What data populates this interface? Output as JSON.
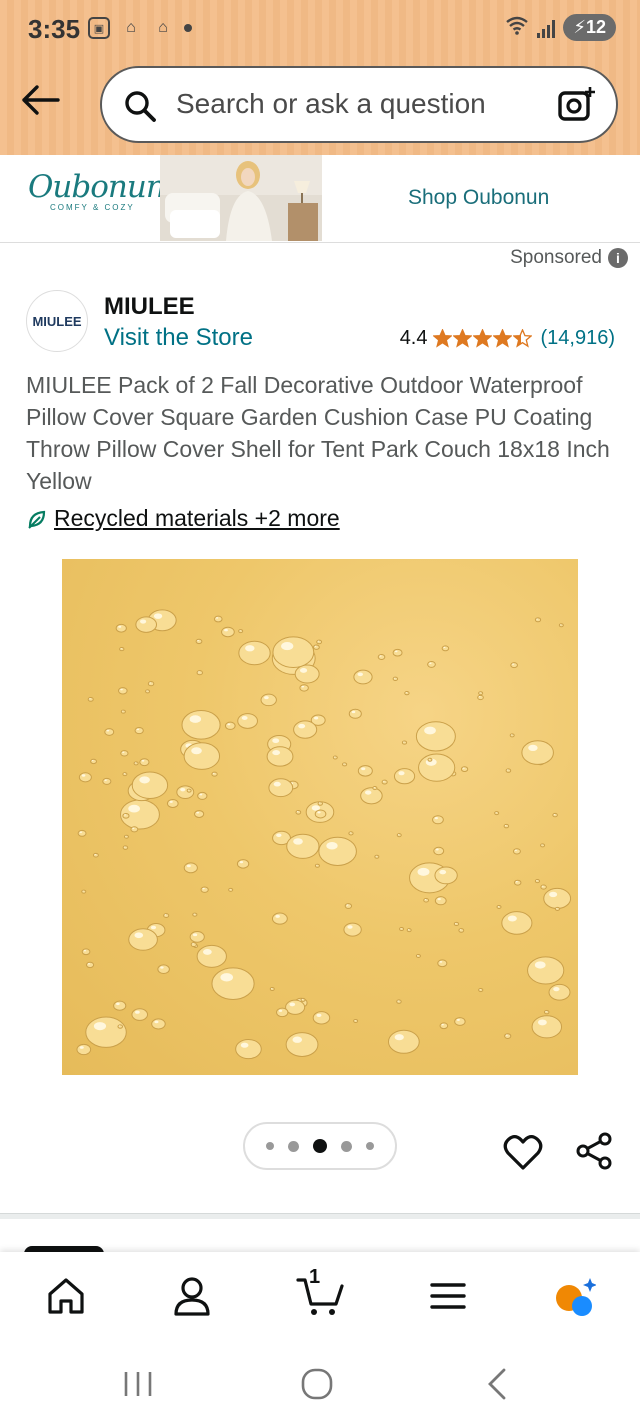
{
  "status_bar": {
    "time": "3:35",
    "battery": "12"
  },
  "search": {
    "placeholder": "Search or ask a question"
  },
  "banner": {
    "brand_name": "Oubonun",
    "brand_tagline": "COMFY & COZY",
    "shop_label": "Shop Oubonun",
    "sponsored_label": "Sponsored"
  },
  "store": {
    "logo_text": "MIULEE",
    "name": "MIULEE",
    "visit_label": "Visit the Store"
  },
  "rating": {
    "value": "4.4",
    "count": "(14,916)",
    "stars_filled": 4.4,
    "stars_total": 5,
    "star_color": "#de7921"
  },
  "product": {
    "title": "MIULEE Pack of 2 Fall Decorative Outdoor Waterproof Pillow Cover Square Garden Cushion Case PU Coating Throw Pillow Cover Shell for Tent Park Couch 18x18 Inch Yellow",
    "badge_label": "Recycled materials +2 more",
    "image_color": "#eec76a"
  },
  "carousel": {
    "count": 5,
    "active_index": 2
  },
  "bottom_nav": {
    "cart_count": "1",
    "items": [
      "home-icon",
      "account-icon",
      "cart-icon",
      "menu-icon",
      "rufus-icon"
    ]
  },
  "colors": {
    "link": "#007185",
    "accent": "#f08804",
    "header_bg": "#f4c08f"
  }
}
